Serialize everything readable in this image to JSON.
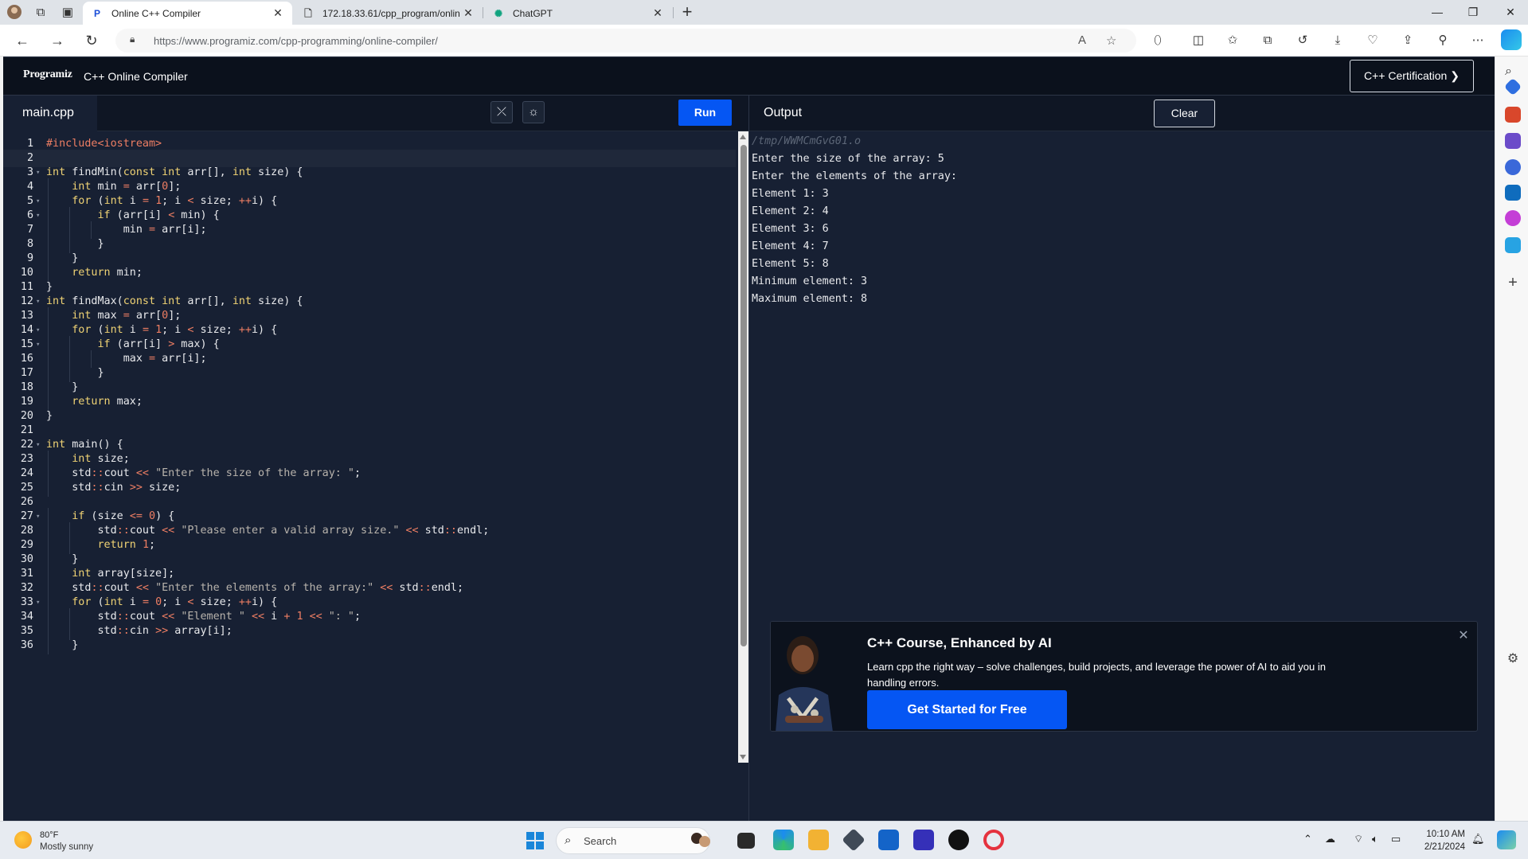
{
  "browser": {
    "tabs": [
      {
        "label": "Online C++ Compiler",
        "favicon": "programiz-icon",
        "active": true
      },
      {
        "label": "172.18.33.61/cpp_program/onlin",
        "favicon": "page-icon",
        "active": false
      },
      {
        "label": "ChatGPT",
        "favicon": "chatgpt-icon",
        "active": false
      }
    ],
    "url": "https://www.programiz.com/cpp-programming/online-compiler/"
  },
  "header": {
    "logo": "Programiz",
    "subtitle": "C++ Online Compiler",
    "cert_button": "C++ Certification ❯"
  },
  "editor": {
    "file_tab": "main.cpp",
    "run_label": "Run",
    "current_line": 2,
    "lines": [
      "#include<iostream>",
      "",
      "int findMin(const int arr[], int size) {",
      "    int min = arr[0];",
      "    for (int i = 1; i < size; ++i) {",
      "        if (arr[i] < min) {",
      "            min = arr[i];",
      "        }",
      "    }",
      "    return min;",
      "}",
      "int findMax(const int arr[], int size) {",
      "    int max = arr[0];",
      "    for (int i = 1; i < size; ++i) {",
      "        if (arr[i] > max) {",
      "            max = arr[i];",
      "        }",
      "    }",
      "    return max;",
      "}",
      "",
      "int main() {",
      "    int size;",
      "    std::cout << \"Enter the size of the array: \";",
      "    std::cin >> size;",
      "",
      "    if (size <= 0) {",
      "        std::cout << \"Please enter a valid array size.\" << std::endl;",
      "        return 1;",
      "    }",
      "    int array[size];",
      "    std::cout << \"Enter the elements of the array:\" << std::endl;",
      "    for (int i = 0; i < size; ++i) {",
      "        std::cout << \"Element \" << i + 1 << \": \";",
      "        std::cin >> array[i];",
      "    }"
    ],
    "folds": [
      3,
      5,
      6,
      12,
      14,
      15,
      22,
      27,
      33
    ]
  },
  "output": {
    "title": "Output",
    "clear_label": "Clear",
    "path": "/tmp/WWMCmGvG01.o",
    "lines": [
      "Enter the size of the array: 5",
      "Enter the elements of the array:",
      "Element 1: 3",
      "Element 2: 4",
      "Element 3: 6",
      "Element 4: 7",
      "Element 5: 8",
      "Minimum element: 3",
      "Maximum element: 8"
    ]
  },
  "promo": {
    "title": "C++ Course, Enhanced by AI",
    "description": "Learn cpp the right way – solve challenges, build projects, and leverage the power of AI to aid you in handling errors.",
    "cta": "Get Started for Free"
  },
  "taskbar": {
    "weather_temp": "80°F",
    "weather_desc": "Mostly sunny",
    "search_placeholder": "Search",
    "time": "10:10 AM",
    "date": "2/21/2024"
  },
  "colors": {
    "accent": "#0556f3",
    "editor_bg": "#172033",
    "keyword": "#efd274",
    "string": "#b8b3ac",
    "number": "#ee7e63"
  }
}
